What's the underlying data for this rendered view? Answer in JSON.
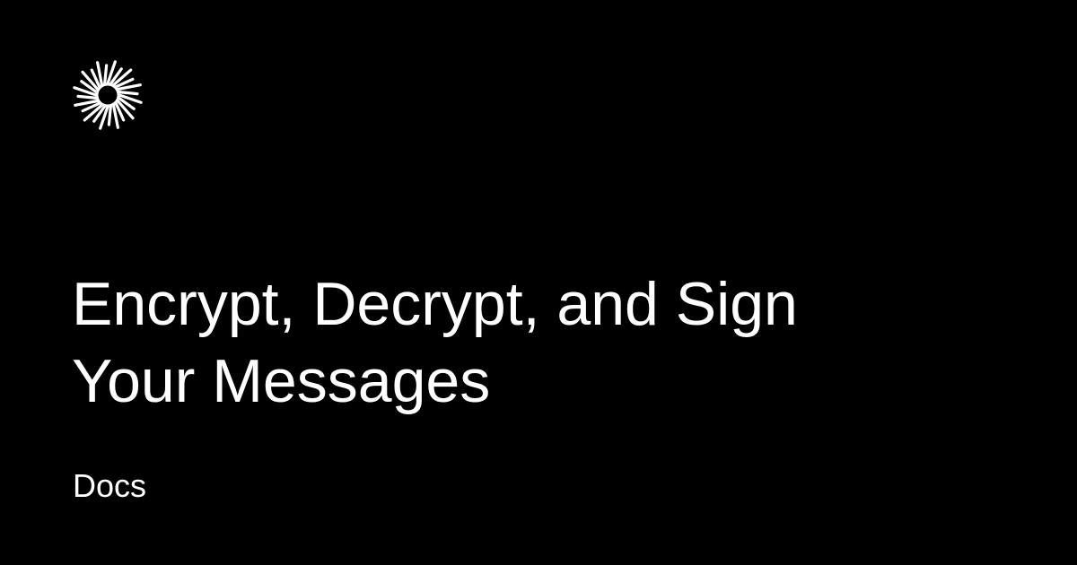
{
  "card": {
    "background": "#000000",
    "text_color": "#ffffff"
  },
  "logo": {
    "icon": "starburst-icon",
    "color": "#ffffff"
  },
  "title": {
    "line1": "Encrypt, Decrypt, and Sign",
    "line2": "Your Messages"
  },
  "section_label": "Docs"
}
